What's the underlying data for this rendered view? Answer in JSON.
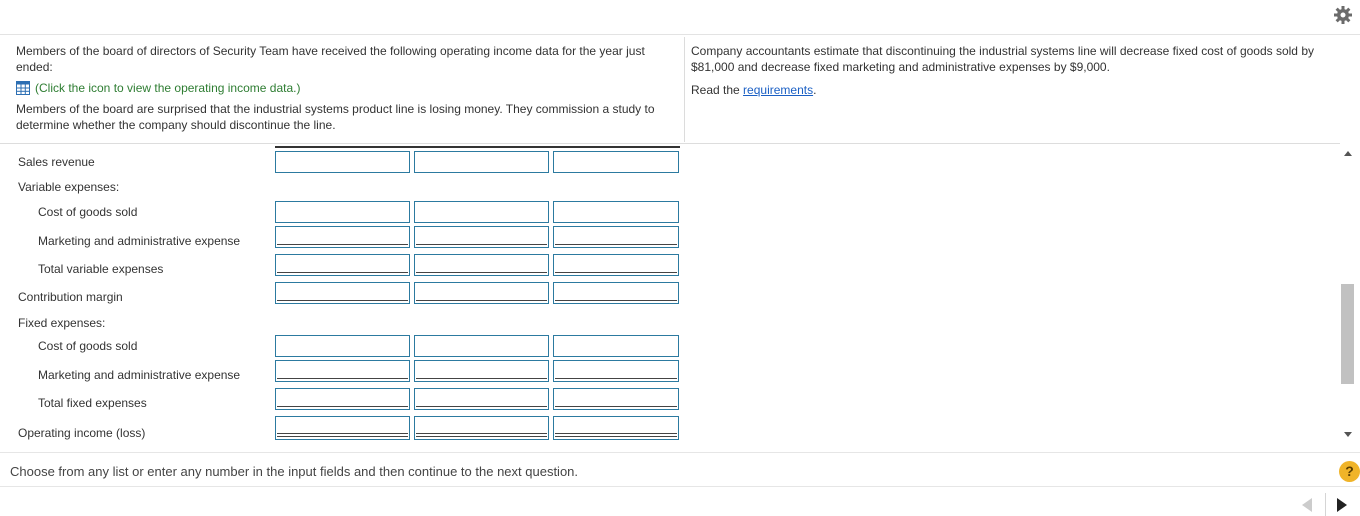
{
  "problem": {
    "left_text_1": "Members of the board of directors of Security Team have received the following operating income data for the year just ended:",
    "data_link": "(Click the icon to view the operating income data.)",
    "left_text_2": "Members of the board are surprised that the industrial systems product line is losing money. They commission a study to determine whether the company should discontinue the line.",
    "right_text": "Company accountants estimate that discontinuing the industrial systems line will decrease fixed cost of goods sold by $81,000 and decrease fixed marketing and administrative expenses by $9,000.",
    "read_prefix": "Read the ",
    "requirements_link": "requirements",
    "read_suffix": "."
  },
  "table": {
    "rows": [
      {
        "label": "Sales revenue"
      },
      {
        "label": "Variable expenses:"
      },
      {
        "label": "Cost of goods sold"
      },
      {
        "label": "Marketing and administrative expense"
      },
      {
        "label": "Total variable expenses"
      },
      {
        "label": "Contribution margin"
      },
      {
        "label": "Fixed expenses:"
      },
      {
        "label": "Cost of goods sold"
      },
      {
        "label": "Marketing and administrative expense"
      },
      {
        "label": "Total fixed expenses"
      },
      {
        "label": "Operating income (loss)"
      }
    ]
  },
  "footer": {
    "instruction": "Choose from any list or enter any number in the input fields and then continue to the next question.",
    "help_label": "?"
  },
  "icons": {
    "settings": "gear-icon",
    "data_table": "table-icon",
    "help": "help-icon",
    "prev": "previous-arrow-icon",
    "next": "next-arrow-icon"
  },
  "colors": {
    "link_green": "#2e7d32",
    "link_blue": "#1a5fc4",
    "input_border": "#2c7aa0",
    "help_yellow": "#f0b429"
  }
}
